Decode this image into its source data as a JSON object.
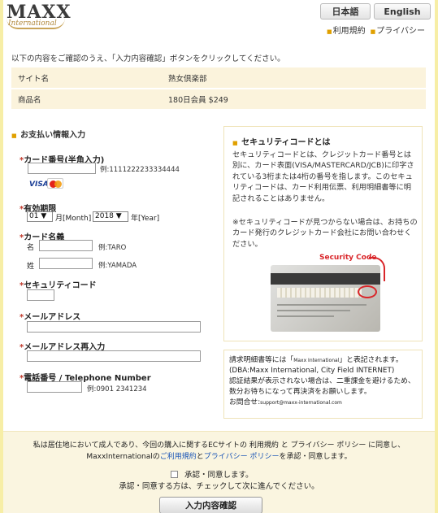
{
  "header": {
    "logo_main": "MAXX",
    "logo_sub": "International",
    "lang_jp": "日本語",
    "lang_en": "English",
    "link_terms": "利用規約",
    "link_privacy": "プライバシー"
  },
  "instruction": "以下の内容をご確認のうえ、「入力内容確認」ボタンをクリックしてください。",
  "product": {
    "site_label": "サイト名",
    "site_value": "熟女倶楽部",
    "item_label": "商品名",
    "item_value": "180日会員 $249"
  },
  "payment": {
    "section_title": "お支払い情報入力",
    "card_number_label": "カード番号(半角入力)",
    "card_number_value": "",
    "card_number_example": "例:1111222233334444",
    "brand_visa": "VISA",
    "expiry_label": "有効期限",
    "expiry_month": "01",
    "expiry_month_unit": "月[Month]",
    "expiry_year": "2018",
    "expiry_year_unit": "年[Year]",
    "holder_label": "カード名義",
    "first_name_label": "名",
    "first_name_example": "例:TARO",
    "last_name_label": "姓",
    "last_name_example": "例:YAMADA",
    "cvv_label": "セキュリティコード",
    "email_label": "メールアドレス",
    "email_confirm_label": "メールアドレス再入力",
    "phone_label": "電話番号 / Telephone Number",
    "phone_example": "例:0901 2341234",
    "required_mark": "*"
  },
  "security_info": {
    "title": "セキュリティコードとは",
    "text1": "セキュリティコードとは、クレジットカード番号とは別に、カード表面(VISA/MASTERCARD/JCB)に印字されている3桁または4桁の番号を指します。このセキュリティコードは、カード利用伝票、利用明細書等に明記されることはありません。",
    "text2": "※セキュリティコードが見つからない場合は、お持ちのカード発行のクレジットカード会社にお問い合わせください。",
    "image_label": "Security Code"
  },
  "billing": {
    "line1a": "請求明細書等には「",
    "line1_name": "Maxx International",
    "line1b": "」と表記されます。",
    "line2": "(DBA:Maxx International, City Field INTERNET)",
    "line3": "認証結果が表示されない場合は、二重課金を避けるため、数分お待ちになって再決済をお願いします。",
    "contact_label": "お問合せ:",
    "contact_email": "support@maxx-international.com"
  },
  "agreement": {
    "text_a": "私は居住地において成人であり、今回の購入に関するECサイトの 利用規約 と プライバシー ポリシー に同意し、",
    "text_b_prefix": "MaxxInternationalの",
    "terms_link": "ご利用規約",
    "and": "と",
    "privacy_link": "プライバシー ポリシー",
    "text_b_suffix": "を承認・同意します。",
    "checkbox_label": "承認・同意します。",
    "checkbox_note": "承認・同意する方は、チェックして次に進んでください。",
    "confirm_button": "入力内容確認"
  }
}
